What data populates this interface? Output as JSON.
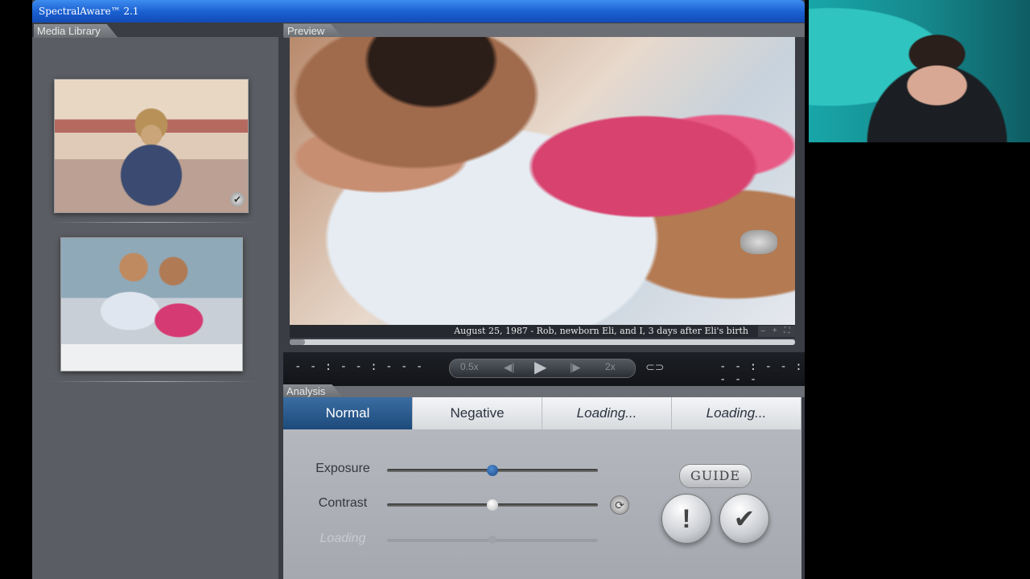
{
  "window": {
    "title": "SpectralAware™ 2.1"
  },
  "library": {
    "tab_label": "Media Library",
    "items": [
      {
        "name": "photo-1",
        "selected": true
      },
      {
        "name": "photo-2",
        "selected": false
      }
    ]
  },
  "preview": {
    "tab_label": "Preview",
    "caption": "August 25, 1987 - Rob, newborn Eli, and I, 3 days after Eli's birth",
    "zoom_controls": "– + ⛶",
    "progress": 0.03
  },
  "transport": {
    "time_left": "- - : - - : - - -",
    "time_right": "- - : - - : - - -",
    "speed_slow": "0.5x",
    "speed_fast": "2x",
    "prev_icon": "prev-frame-icon",
    "play_icon": "play-icon",
    "next_icon": "next-frame-icon",
    "loop_icon": "loop-icon"
  },
  "analysis": {
    "tab_label": "Analysis",
    "tabs": [
      {
        "label": "Normal",
        "active": true
      },
      {
        "label": "Negative",
        "active": false
      },
      {
        "label": "Loading...",
        "active": false
      },
      {
        "label": "Loading...",
        "active": false
      }
    ],
    "sliders": [
      {
        "label": "Exposure",
        "value": 0.5
      },
      {
        "label": "Contrast",
        "value": 0.5
      },
      {
        "label": "Loading",
        "value": 0.5
      }
    ],
    "guide_label": "GUIDE",
    "alert_symbol": "!",
    "confirm_symbol": "✔"
  },
  "colors": {
    "title_blue": "#1a5fd0",
    "active_tab": "#2a5c92",
    "knob_blue": "#2a62a8"
  }
}
